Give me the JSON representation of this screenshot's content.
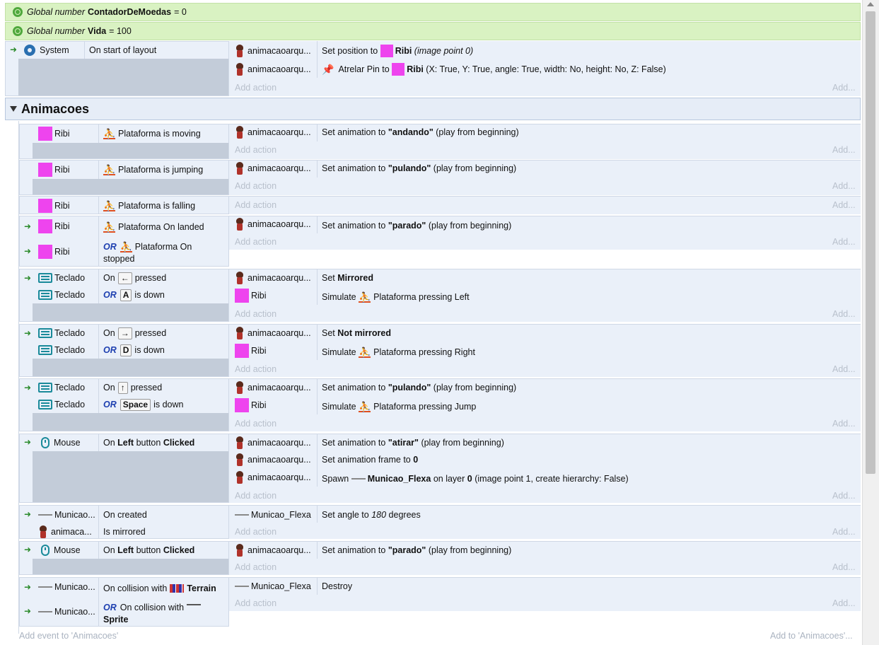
{
  "globals": [
    {
      "prefix": "Global number",
      "name": "ContadorDeMoedas",
      "value": "= 0"
    },
    {
      "prefix": "Global number",
      "name": "Vida",
      "value": "= 100"
    }
  ],
  "system_event": {
    "object": "System",
    "condition": "On start of layout",
    "actions": [
      {
        "object": "animacaoarqu...",
        "text_pre": "Set position to",
        "target": "Ribi",
        "text_post": "(image point 0)"
      },
      {
        "object": "animacaoarqu...",
        "text_pre": "Atrelar Pin to",
        "target": "Ribi",
        "text_post": "(X: True, Y: True, angle: True, width: No, height: No, Z: False)"
      }
    ]
  },
  "add_action": "Add action",
  "add_short": "Add...",
  "group": {
    "name": "Animacoes",
    "add_event": "Add event to 'Animacoes'",
    "add_to": "Add to 'Animacoes'..."
  },
  "events": {
    "e1": {
      "obj": "Ribi",
      "cond": "Plataforma is moving",
      "aobj": "animacaoarqu...",
      "apre": "Set animation to",
      "aval": "\"andando\"",
      "apost": "(play from beginning)"
    },
    "e2": {
      "obj": "Ribi",
      "cond": "Plataforma is jumping",
      "aobj": "animacaoarqu...",
      "apre": "Set animation to",
      "aval": "\"pulando\"",
      "apost": "(play from beginning)"
    },
    "e3": {
      "obj": "Ribi",
      "cond": "Plataforma is falling"
    },
    "e4": {
      "obj1": "Ribi",
      "cond1": "Plataforma On landed",
      "obj2": "Ribi",
      "or": "OR",
      "cond2a": "Plataforma On",
      "cond2b": "stopped",
      "aobj": "animacaoarqu...",
      "apre": "Set animation to",
      "aval": "\"parado\"",
      "apost": "(play from beginning)"
    },
    "e5": {
      "obj1": "Teclado",
      "on": "On",
      "key1": "←",
      "pressed": "pressed",
      "obj2": "Teclado",
      "or": "OR",
      "key2": "A",
      "isdown": "is down",
      "a1obj": "animacaoarqu...",
      "a1pre": "Set",
      "a1val": "Mirrored",
      "a2obj": "Ribi",
      "a2pre": "Simulate",
      "a2post": "Plataforma pressing Left"
    },
    "e6": {
      "obj1": "Teclado",
      "on": "On",
      "key1": "→",
      "pressed": "pressed",
      "obj2": "Teclado",
      "or": "OR",
      "key2": "D",
      "isdown": "is down",
      "a1obj": "animacaoarqu...",
      "a1pre": "Set",
      "a1val": "Not mirrored",
      "a2obj": "Ribi",
      "a2pre": "Simulate",
      "a2post": "Plataforma pressing Right"
    },
    "e7": {
      "obj1": "Teclado",
      "on": "On",
      "key1": "↑",
      "pressed": "pressed",
      "obj2": "Teclado",
      "or": "OR",
      "key2": "Space",
      "isdown": "is down",
      "a1obj": "animacaoarqu...",
      "a1pre": "Set animation to",
      "a1val": "\"pulando\"",
      "a1post": "(play from beginning)",
      "a2obj": "Ribi",
      "a2pre": "Simulate",
      "a2post": "Plataforma pressing Jump"
    },
    "e8": {
      "obj": "Mouse",
      "on": "On",
      "btn": "Left",
      "btnmid": "button",
      "clicked": "Clicked",
      "a1obj": "animacaoarqu...",
      "a1pre": "Set animation to",
      "a1val": "\"atirar\"",
      "a1post": "(play from beginning)",
      "a2obj": "animacaoarqu...",
      "a2pre": "Set animation frame to",
      "a2val": "0",
      "a3obj": "animacaoarqu...",
      "a3pre": "Spawn",
      "a3target": "Municao_Flexa",
      "a3mid": "on layer",
      "a3layer": "0",
      "a3post": "(image point 1, create hierarchy: False)"
    },
    "e9": {
      "obj1": "Municao...",
      "cond1": "On created",
      "obj2": "animaca...",
      "cond2": "Is mirrored",
      "aobj": "Municao_Flexa",
      "apre": "Set angle to",
      "aval": "180",
      "apost": "degrees"
    },
    "e10": {
      "obj": "Mouse",
      "on": "On",
      "btn": "Left",
      "btnmid": "button",
      "clicked": "Clicked",
      "aobj": "animacaoarqu...",
      "apre": "Set animation to",
      "aval": "\"parado\"",
      "apost": "(play from beginning)"
    },
    "e11": {
      "obj1": "Municao...",
      "cond1": "On collision with",
      "target1": "Terrain",
      "obj2": "Municao...",
      "or": "OR",
      "cond2": "On collision with",
      "target2": "Sprite",
      "aobj": "Municao_Flexa",
      "atext": "Destroy"
    }
  }
}
